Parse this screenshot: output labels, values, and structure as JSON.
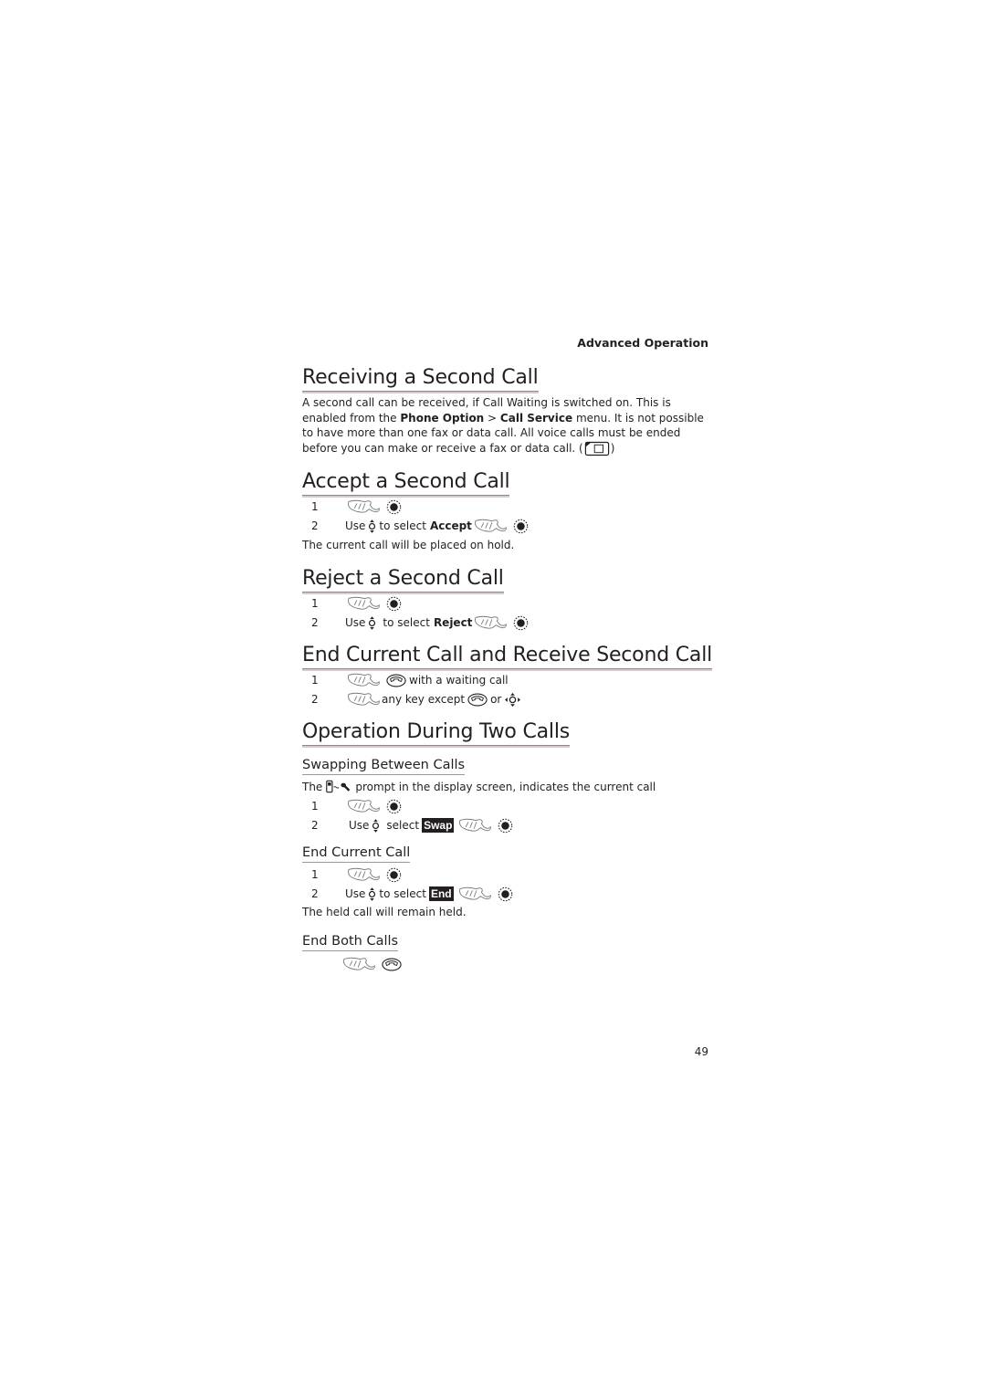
{
  "header": {
    "running_title": "Advanced Operation"
  },
  "sections": {
    "receiving": {
      "title": "Receiving a Second Call",
      "para_1": "A second call can be received, if Call Waiting is switched on. This is enabled from the ",
      "menu_a": "Phone Option",
      "sep": " > ",
      "menu_b": "Call Service",
      "para_2": " menu. It is not possible to have more than one fax or data call. All voice calls must be ended before you can make or receive a fax or data call. (",
      "para_3": ")",
      "note_icon": "sim-card-icon"
    },
    "accept": {
      "title": "Accept a Second Call",
      "steps": [
        {
          "num": "1"
        },
        {
          "num": "2",
          "pre": "Use",
          "mid": "to select",
          "keyword": "Accept"
        }
      ],
      "note": "The current call will be placed on hold."
    },
    "reject": {
      "title": "Reject a Second Call",
      "steps": [
        {
          "num": "1"
        },
        {
          "num": "2",
          "pre": "Use",
          "mid": "to select",
          "keyword": "Reject"
        }
      ]
    },
    "end_receive": {
      "title": "End Current Call and Receive Second Call",
      "steps": [
        {
          "num": "1",
          "text": "with a waiting call"
        },
        {
          "num": "2",
          "text_a": "any key except",
          "text_b": "or"
        }
      ]
    },
    "two_calls": {
      "title": "Operation During Two Calls",
      "swapping": {
        "title": "Swapping Between Calls",
        "intro_a": "The",
        "intro_b": "prompt in the display screen, indicates the current call",
        "steps": [
          {
            "num": "1"
          },
          {
            "num": "2",
            "pre": "Use",
            "mid": "select",
            "keyword": "Swap"
          }
        ]
      },
      "end_current": {
        "title": "End Current Call",
        "steps": [
          {
            "num": "1"
          },
          {
            "num": "2",
            "pre": "Use",
            "mid": "to select",
            "keyword": "End"
          }
        ],
        "note": "The held call will remain held."
      },
      "end_both": {
        "title": "End Both Calls"
      }
    }
  },
  "icons": {
    "press": "hand-press-icon",
    "ok": "ok-key-icon",
    "nav": "navigation-key-icon",
    "end": "end-call-key-icon",
    "nav4": "four-way-navigation-icon",
    "prompt": "call-swap-prompt-icon"
  },
  "footer": {
    "page_number": "49"
  }
}
